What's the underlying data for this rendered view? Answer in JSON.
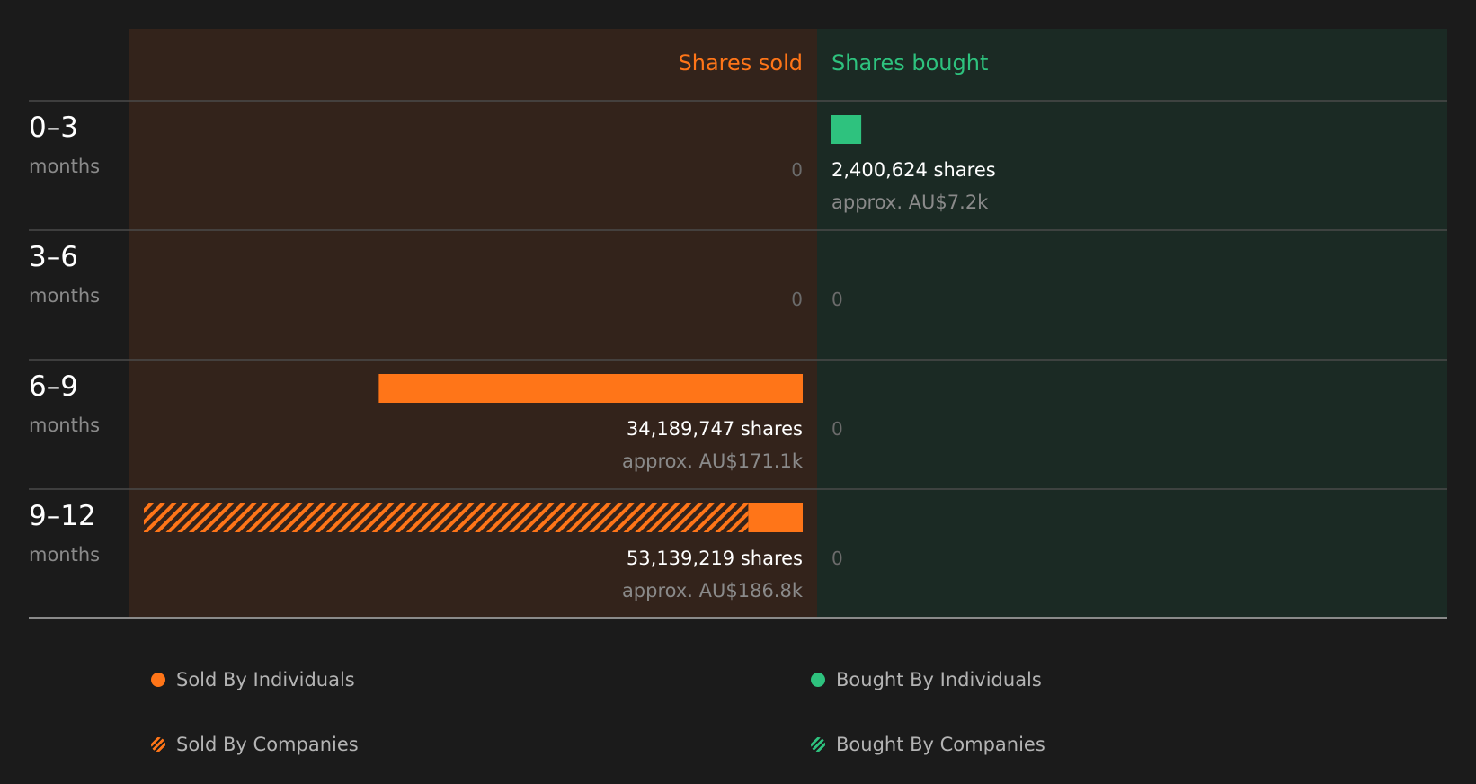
{
  "colors": {
    "sold": "#ff7518",
    "bought": "#2ec27e",
    "sold_bg": "#33231b",
    "bought_bg": "#1b2a24",
    "page_bg": "#1b1b1b",
    "muted": "#8a8a8a",
    "zero": "#6b6b6b",
    "value": "#ffffff",
    "divider": "#4a4a4a"
  },
  "chart_data": {
    "type": "bar",
    "orientation": "horizontal-diverging",
    "headers": {
      "sold": "Shares sold",
      "bought": "Shares bought"
    },
    "period_unit": "months",
    "categories": [
      "0–3",
      "3–6",
      "6–9",
      "9–12"
    ],
    "series": [
      {
        "name": "Sold By Individuals",
        "side": "sold",
        "style": "solid",
        "values": [
          0,
          0,
          34189747,
          4400000
        ]
      },
      {
        "name": "Sold By Companies",
        "side": "sold",
        "style": "hatched",
        "values": [
          0,
          0,
          0,
          48739219
        ]
      },
      {
        "name": "Bought By Individuals",
        "side": "bought",
        "style": "solid",
        "values": [
          2400624,
          0,
          0,
          0
        ]
      },
      {
        "name": "Bought By Companies",
        "side": "bought",
        "style": "hatched",
        "values": [
          0,
          0,
          0,
          0
        ]
      }
    ],
    "rows": [
      {
        "period": "0–3",
        "sold": {
          "shares": "0",
          "approx": ""
        },
        "bought": {
          "shares": "2,400,624 shares",
          "approx": "approx. AU$7.2k"
        }
      },
      {
        "period": "3–6",
        "sold": {
          "shares": "0",
          "approx": ""
        },
        "bought": {
          "shares": "0",
          "approx": ""
        }
      },
      {
        "period": "6–9",
        "sold": {
          "shares": "34,189,747 shares",
          "approx": "approx. AU$171.1k"
        },
        "bought": {
          "shares": "0",
          "approx": ""
        }
      },
      {
        "period": "9–12",
        "sold": {
          "shares": "53,139,219 shares",
          "approx": "approx. AU$186.8k"
        },
        "bought": {
          "shares": "0",
          "approx": ""
        }
      }
    ],
    "xlim": [
      0,
      53139219
    ],
    "legend": [
      {
        "label": "Sold By Individuals",
        "color": "#ff7518",
        "style": "solid"
      },
      {
        "label": "Bought By Individuals",
        "color": "#2ec27e",
        "style": "solid"
      },
      {
        "label": "Sold By Companies",
        "color": "#ff7518",
        "style": "hatched"
      },
      {
        "label": "Bought By Companies",
        "color": "#2ec27e",
        "style": "hatched"
      }
    ],
    "legend_position": "bottom",
    "grid": false
  }
}
